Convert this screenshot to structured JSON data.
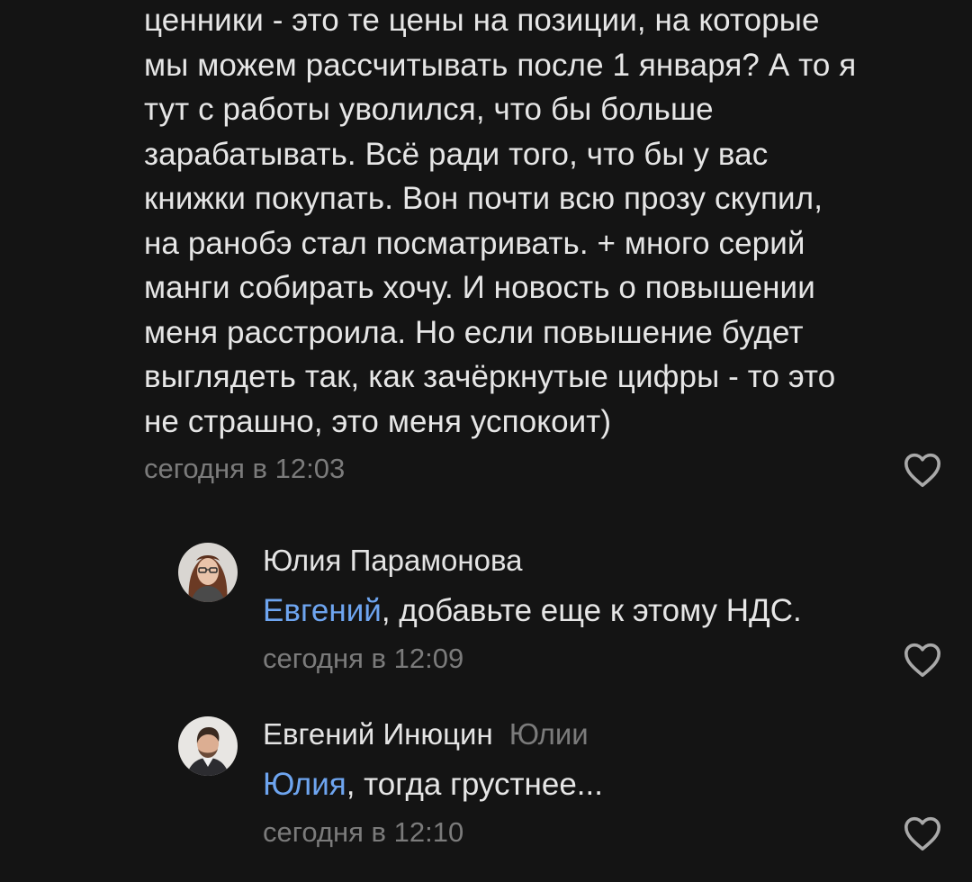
{
  "comment": {
    "lines": [
      "ценники - это те цены на позиции, на которые",
      "мы можем рассчитывать после 1 января? А то я",
      "тут с работы уволился, что бы больше",
      "зарабатывать. Всё ради того, что бы у вас",
      "книжки покупать. Вон почти всю прозу скупил,",
      "на ранобэ стал посматривать. + много серий",
      "манги собирать хочу. И новость о повышении",
      "меня расстроила. Но если повышение будет",
      "выглядеть так, как зачёркнутые цифры - то это",
      "не страшно, это меня успокоит)"
    ],
    "time": "сегодня в 12:03",
    "like_icon": "heart-outline-icon"
  },
  "replies": [
    {
      "author": "Юлия Парамонова",
      "reply_to": "",
      "mention": "Евгений",
      "text": ", добавьте еще к этому НДС.",
      "time": "сегодня в 12:09",
      "avatar_icon": "user-avatar-woman",
      "like_icon": "heart-outline-icon"
    },
    {
      "author": "Евгений Инюцин",
      "reply_to": "Юлии",
      "mention": "Юлия",
      "text": ", тогда грустнее...",
      "time": "сегодня в 12:10",
      "avatar_icon": "user-avatar-man",
      "like_icon": "heart-outline-icon"
    }
  ],
  "colors": {
    "background": "#141414",
    "text": "#e6e6e6",
    "muted": "#7b7b7b",
    "mention": "#6ea5f0"
  }
}
